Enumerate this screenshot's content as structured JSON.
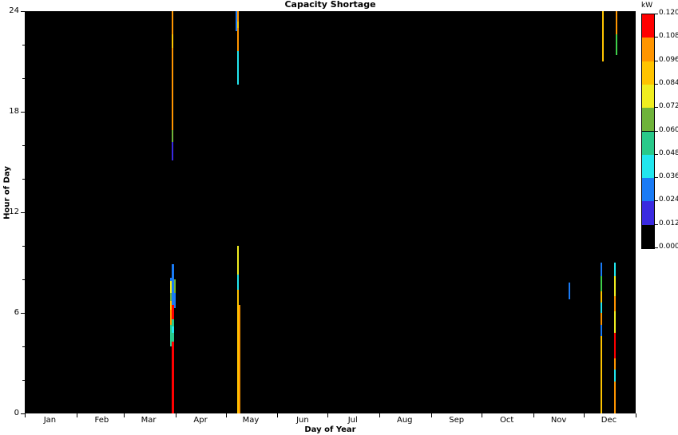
{
  "chart_data": {
    "type": "heatmap",
    "title": "Capacity Shortage",
    "xlabel": "Day of Year",
    "ylabel": "Hour of Day",
    "colorbar_title": "kW",
    "xlim": [
      0,
      365
    ],
    "ylim": [
      0,
      24
    ],
    "y_ticks": [
      0,
      6,
      12,
      18,
      24
    ],
    "y_tick_labels": [
      "0",
      "6",
      "12",
      "18",
      "24"
    ],
    "y_minor_ticks": [
      2,
      4,
      8,
      10,
      14,
      16,
      20,
      22
    ],
    "x_tick_labels": [
      "Jan",
      "Feb",
      "Mar",
      "Apr",
      "May",
      "Jun",
      "Jul",
      "Aug",
      "Sep",
      "Oct",
      "Nov",
      "Dec"
    ],
    "x_tick_positions": [
      15,
      46,
      74,
      105,
      135,
      166,
      196,
      227,
      258,
      288,
      319,
      349
    ],
    "x_tick_boundaries": [
      0,
      31,
      59,
      90,
      120,
      151,
      181,
      212,
      243,
      273,
      304,
      334,
      365
    ],
    "grid": false,
    "background": "#000000",
    "colorbar": {
      "min": 0.0,
      "max": 0.12,
      "tick_labels": [
        "0.120",
        "0.108",
        "0.096",
        "0.084",
        "0.072",
        "0.060",
        "0.048",
        "0.036",
        "0.024",
        "0.012",
        "0.000"
      ],
      "tick_values": [
        0.12,
        0.108,
        0.096,
        0.084,
        0.072,
        0.06,
        0.048,
        0.036,
        0.024,
        0.012,
        0.0
      ],
      "band_colors": [
        "#ff0000",
        "#ff9500",
        "#ffc400",
        "#f0ee20",
        "#6fb33a",
        "#29c98a",
        "#22e6ee",
        "#1a7bf5",
        "#3a2ae0",
        "#000000"
      ],
      "band_ranges": [
        [
          0.108,
          0.12
        ],
        [
          0.096,
          0.108
        ],
        [
          0.084,
          0.096
        ],
        [
          0.072,
          0.084
        ],
        [
          0.06,
          0.072
        ],
        [
          0.048,
          0.06
        ],
        [
          0.036,
          0.048
        ],
        [
          0.024,
          0.036
        ],
        [
          0.012,
          0.024
        ],
        [
          0.0,
          0.012
        ]
      ]
    },
    "columns": [
      {
        "day": 88,
        "width_days": 1.0,
        "segments": [
          {
            "hour_start": 0.0,
            "hour_end": 4.3,
            "color": "#ff0000",
            "value": 0.115
          },
          {
            "hour_start": 4.3,
            "hour_end": 4.8,
            "color": "#29c98a",
            "value": 0.055
          },
          {
            "hour_start": 4.8,
            "hour_end": 5.2,
            "color": "#22e6ee",
            "value": 0.042
          },
          {
            "hour_start": 5.2,
            "hour_end": 5.6,
            "color": "#29c98a",
            "value": 0.055
          },
          {
            "hour_start": 5.6,
            "hour_end": 6.0,
            "color": "#ff0000",
            "value": 0.114
          },
          {
            "hour_start": 6.0,
            "hour_end": 6.5,
            "color": "#ff0000",
            "value": 0.112
          },
          {
            "hour_start": 6.5,
            "hour_end": 7.1,
            "color": "#1a7bf5",
            "value": 0.03
          },
          {
            "hour_start": 7.1,
            "hour_end": 7.6,
            "color": "#1a7bf5",
            "value": 0.031
          },
          {
            "hour_start": 7.6,
            "hour_end": 8.9,
            "color": "#1a7bf5",
            "value": 0.029
          }
        ]
      },
      {
        "day": 87,
        "width_days": 0.9,
        "segments": [
          {
            "hour_start": 4.0,
            "hour_end": 4.6,
            "color": "#29c98a",
            "value": 0.056
          },
          {
            "hour_start": 4.6,
            "hour_end": 5.3,
            "color": "#29c98a",
            "value": 0.054
          },
          {
            "hour_start": 5.3,
            "hour_end": 6.2,
            "color": "#ff9500",
            "value": 0.1
          },
          {
            "hour_start": 6.2,
            "hour_end": 6.7,
            "color": "#ffc400",
            "value": 0.09
          },
          {
            "hour_start": 6.7,
            "hour_end": 7.2,
            "color": "#6fb33a",
            "value": 0.066
          },
          {
            "hour_start": 7.2,
            "hour_end": 7.9,
            "color": "#f0ee20",
            "value": 0.078
          },
          {
            "hour_start": 7.9,
            "hour_end": 8.1,
            "color": "#1a7bf5",
            "value": 0.03
          }
        ]
      },
      {
        "day": 89,
        "width_days": 0.8,
        "segments": [
          {
            "hour_start": 6.3,
            "hour_end": 7.2,
            "color": "#1a7bf5",
            "value": 0.03
          },
          {
            "hour_start": 7.2,
            "hour_end": 8.0,
            "color": "#6fb33a",
            "value": 0.068
          }
        ]
      },
      {
        "day": 88,
        "width_days": 0.9,
        "label": "april-upper",
        "segments": [
          {
            "hour_start": 15.1,
            "hour_end": 16.2,
            "color": "#3a2ae0",
            "value": 0.018
          },
          {
            "hour_start": 16.2,
            "hour_end": 16.9,
            "color": "#6fb33a",
            "value": 0.066
          },
          {
            "hour_start": 16.9,
            "hour_end": 21.8,
            "color": "#ff9500",
            "value": 0.103
          },
          {
            "hour_start": 21.8,
            "hour_end": 22.6,
            "color": "#ffc400",
            "value": 0.092
          },
          {
            "hour_start": 22.6,
            "hour_end": 24.0,
            "color": "#ff9500",
            "value": 0.1
          }
        ]
      },
      {
        "day": 127,
        "width_days": 1.0,
        "label": "may-upper",
        "segments": [
          {
            "hour_start": 19.6,
            "hour_end": 21.6,
            "color": "#22e6ee",
            "value": 0.044
          },
          {
            "hour_start": 21.6,
            "hour_end": 23.0,
            "color": "#ff9500",
            "value": 0.102
          },
          {
            "hour_start": 23.0,
            "hour_end": 23.4,
            "color": "#ffc400",
            "value": 0.09
          },
          {
            "hour_start": 23.4,
            "hour_end": 24.0,
            "color": "#ff9500",
            "value": 0.1
          }
        ]
      },
      {
        "day": 126,
        "width_days": 0.8,
        "label": "may-upper-blue",
        "segments": [
          {
            "hour_start": 22.8,
            "hour_end": 24.0,
            "color": "#1a7bf5",
            "value": 0.03
          }
        ]
      },
      {
        "day": 127,
        "width_days": 1.0,
        "label": "may-lower",
        "segments": [
          {
            "hour_start": 0.0,
            "hour_end": 6.4,
            "color": "#ffc400",
            "value": 0.089
          },
          {
            "hour_start": 6.4,
            "hour_end": 7.4,
            "color": "#ffc400",
            "value": 0.09
          },
          {
            "hour_start": 7.4,
            "hour_end": 8.3,
            "color": "#22e6ee",
            "value": 0.044
          },
          {
            "hour_start": 8.3,
            "hour_end": 10.0,
            "color": "#f0ee20",
            "value": 0.08
          }
        ]
      },
      {
        "day": 128,
        "width_days": 0.9,
        "label": "may-lower-orange",
        "segments": [
          {
            "hour_start": 0.0,
            "hour_end": 6.5,
            "color": "#ff9500",
            "value": 0.099
          }
        ]
      },
      {
        "day": 325,
        "width_days": 0.7,
        "label": "november",
        "segments": [
          {
            "hour_start": 6.8,
            "hour_end": 7.8,
            "color": "#1a7bf5",
            "value": 0.029
          }
        ]
      },
      {
        "day": 344,
        "width_days": 1.0,
        "label": "dec-a",
        "segments": [
          {
            "hour_start": 0.0,
            "hour_end": 4.6,
            "color": "#ffc400",
            "value": 0.09
          },
          {
            "hour_start": 4.6,
            "hour_end": 5.3,
            "color": "#1a7bf5",
            "value": 0.03
          },
          {
            "hour_start": 5.3,
            "hour_end": 6.0,
            "color": "#ff9500",
            "value": 0.1
          },
          {
            "hour_start": 6.0,
            "hour_end": 6.6,
            "color": "#22e6ee",
            "value": 0.043
          },
          {
            "hour_start": 6.6,
            "hour_end": 7.3,
            "color": "#ffc400",
            "value": 0.089
          },
          {
            "hour_start": 7.3,
            "hour_end": 8.2,
            "color": "#3ecf4a",
            "value": 0.064
          },
          {
            "hour_start": 8.2,
            "hour_end": 9.0,
            "color": "#1a7bf5",
            "value": 0.031
          }
        ]
      },
      {
        "day": 345,
        "width_days": 0.8,
        "label": "dec-a-upper",
        "segments": [
          {
            "hour_start": 21.0,
            "hour_end": 24.0,
            "color": "#ffc400",
            "value": 0.091
          }
        ]
      },
      {
        "day": 352,
        "width_days": 1.0,
        "label": "dec-b",
        "segments": [
          {
            "hour_start": 0.0,
            "hour_end": 1.9,
            "color": "#ff9500",
            "value": 0.1
          },
          {
            "hour_start": 1.9,
            "hour_end": 2.6,
            "color": "#22e6ee",
            "value": 0.044
          },
          {
            "hour_start": 2.6,
            "hour_end": 3.3,
            "color": "#ff9500",
            "value": 0.099
          },
          {
            "hour_start": 3.3,
            "hour_end": 4.8,
            "color": "#ff0000",
            "value": 0.114
          },
          {
            "hour_start": 4.8,
            "hour_end": 6.1,
            "color": "#f0ee20",
            "value": 0.08
          },
          {
            "hour_start": 6.1,
            "hour_end": 7.0,
            "color": "#ff9500",
            "value": 0.101
          },
          {
            "hour_start": 7.0,
            "hour_end": 8.2,
            "color": "#f0ee20",
            "value": 0.079
          },
          {
            "hour_start": 8.2,
            "hour_end": 9.0,
            "color": "#22e6ee",
            "value": 0.043
          }
        ]
      },
      {
        "day": 353,
        "width_days": 0.8,
        "label": "dec-b-upper",
        "segments": [
          {
            "hour_start": 21.4,
            "hour_end": 22.6,
            "color": "#3ecf4a",
            "value": 0.064
          },
          {
            "hour_start": 22.6,
            "hour_end": 24.0,
            "color": "#ff9500",
            "value": 0.102
          }
        ]
      },
      {
        "day": 352,
        "width_days": 0.6,
        "label": "dec-b-tail",
        "segments": [
          {
            "hour_start": 0.0,
            "hour_end": 0.4,
            "color": "#ff9500",
            "value": 0.1
          }
        ]
      }
    ]
  }
}
